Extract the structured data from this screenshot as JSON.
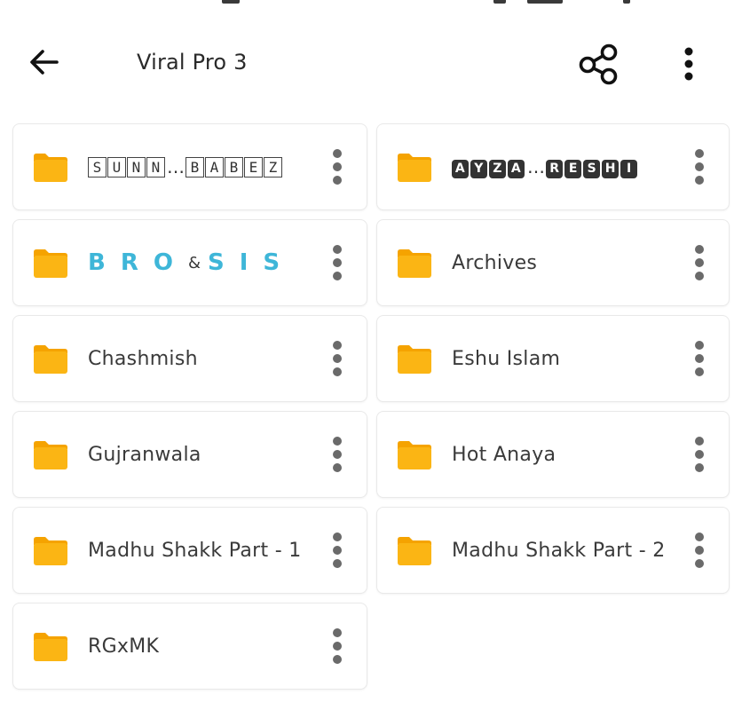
{
  "header": {
    "title": "Viral Pro 3",
    "back_icon": "arrow-back-icon",
    "share_icon": "share-icon",
    "more_icon": "more-vert-icon"
  },
  "colors": {
    "folder": "#fbb514",
    "folder_dark": "#f5a300",
    "brosis": "#3eb6d8"
  },
  "folders": [
    {
      "label": "SUNN…BABEZ",
      "style": "boxed",
      "parts": [
        "SUNN",
        "BABEZ"
      ]
    },
    {
      "label": "AYZA…RESHI",
      "style": "dark",
      "parts": [
        "AYZA",
        "RESHI"
      ]
    },
    {
      "label": "BRO&SIS",
      "style": "brosis",
      "parts": [
        "BRO",
        "&",
        "SIS"
      ]
    },
    {
      "label": "Archives",
      "style": "plain"
    },
    {
      "label": "Chashmish",
      "style": "plain"
    },
    {
      "label": "Eshu Islam",
      "style": "plain"
    },
    {
      "label": "Gujranwala",
      "style": "plain"
    },
    {
      "label": "Hot Anaya",
      "style": "plain"
    },
    {
      "label": "Madhu Shakk Part - 1",
      "style": "plain"
    },
    {
      "label": "Madhu Shakk Part - 2",
      "style": "plain"
    },
    {
      "label": "RGxMK",
      "style": "plain"
    }
  ]
}
